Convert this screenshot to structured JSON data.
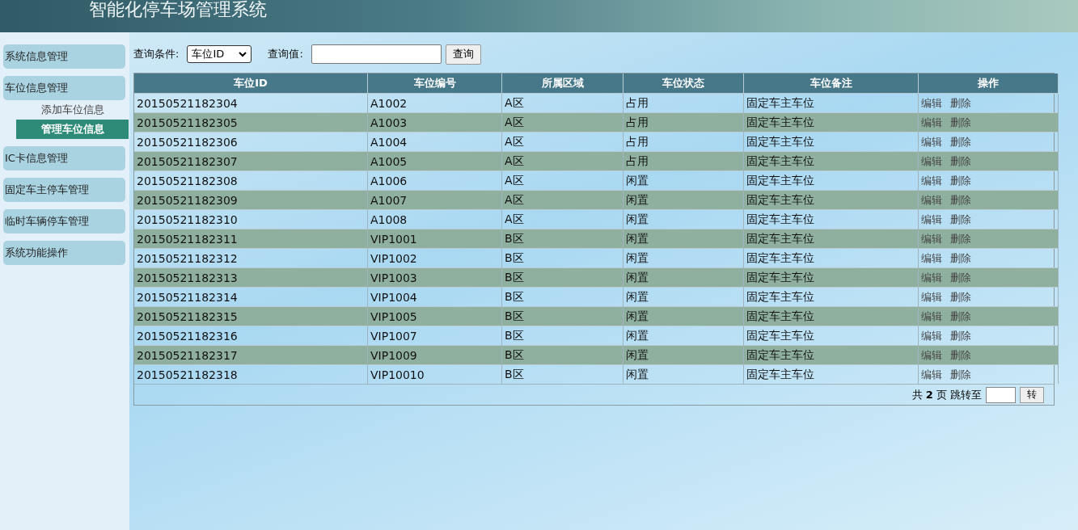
{
  "header": {
    "title": "智能化停车场管理系统"
  },
  "sidebar": {
    "groups": [
      {
        "label": "系统信息管理"
      },
      {
        "label": "车位信息管理",
        "children": [
          {
            "label": "添加车位信息",
            "selected": false
          },
          {
            "label": "管理车位信息",
            "selected": true
          }
        ]
      },
      {
        "label": "IC卡信息管理"
      },
      {
        "label": "固定车主停车管理"
      },
      {
        "label": "临时车辆停车管理"
      },
      {
        "label": "系统功能操作"
      }
    ]
  },
  "query": {
    "condition_label": "查询条件:",
    "condition_value": "车位ID",
    "value_label": "查询值:",
    "button": "查询"
  },
  "table": {
    "columns": [
      "车位ID",
      "车位编号",
      "所属区域",
      "车位状态",
      "车位备注",
      "操作"
    ],
    "rows": [
      {
        "cells": [
          "20150521182304",
          "A1002",
          "A区",
          "占用",
          "固定车主车位"
        ],
        "actions": [
          "编辑",
          "删除"
        ]
      },
      {
        "cells": [
          "20150521182305",
          "A1003",
          "A区",
          "占用",
          "固定车主车位"
        ],
        "actions": [
          "编辑",
          "删除"
        ]
      },
      {
        "cells": [
          "20150521182306",
          "A1004",
          "A区",
          "占用",
          "固定车主车位"
        ],
        "actions": [
          "编辑",
          "删除"
        ]
      },
      {
        "cells": [
          "20150521182307",
          "A1005",
          "A区",
          "占用",
          "固定车主车位"
        ],
        "actions": [
          "编辑",
          "删除"
        ]
      },
      {
        "cells": [
          "20150521182308",
          "A1006",
          "A区",
          "闲置",
          "固定车主车位"
        ],
        "actions": [
          "编辑",
          "删除"
        ]
      },
      {
        "cells": [
          "20150521182309",
          "A1007",
          "A区",
          "闲置",
          "固定车主车位"
        ],
        "actions": [
          "编辑",
          "删除"
        ]
      },
      {
        "cells": [
          "20150521182310",
          "A1008",
          "A区",
          "闲置",
          "固定车主车位"
        ],
        "actions": [
          "编辑",
          "删除"
        ]
      },
      {
        "cells": [
          "20150521182311",
          "VIP1001",
          "B区",
          "闲置",
          "固定车主车位"
        ],
        "actions": [
          "编辑",
          "删除"
        ]
      },
      {
        "cells": [
          "20150521182312",
          "VIP1002",
          "B区",
          "闲置",
          "固定车主车位"
        ],
        "actions": [
          "编辑",
          "删除"
        ]
      },
      {
        "cells": [
          "20150521182313",
          "VIP1003",
          "B区",
          "闲置",
          "固定车主车位"
        ],
        "actions": [
          "编辑",
          "删除"
        ]
      },
      {
        "cells": [
          "20150521182314",
          "VIP1004",
          "B区",
          "闲置",
          "固定车主车位"
        ],
        "actions": [
          "编辑",
          "删除"
        ]
      },
      {
        "cells": [
          "20150521182315",
          "VIP1005",
          "B区",
          "闲置",
          "固定车主车位"
        ],
        "actions": [
          "编辑",
          "删除"
        ]
      },
      {
        "cells": [
          "20150521182316",
          "VIP1007",
          "B区",
          "闲置",
          "固定车主车位"
        ],
        "actions": [
          "编辑",
          "删除"
        ]
      },
      {
        "cells": [
          "20150521182317",
          "VIP1009",
          "B区",
          "闲置",
          "固定车主车位"
        ],
        "actions": [
          "编辑",
          "删除"
        ]
      },
      {
        "cells": [
          "20150521182318",
          "VIP10010",
          "B区",
          "闲置",
          "固定车主车位"
        ],
        "actions": [
          "编辑",
          "删除"
        ]
      }
    ]
  },
  "pagination": {
    "text": "共 **2** 页 跳转至",
    "button": "转"
  }
}
